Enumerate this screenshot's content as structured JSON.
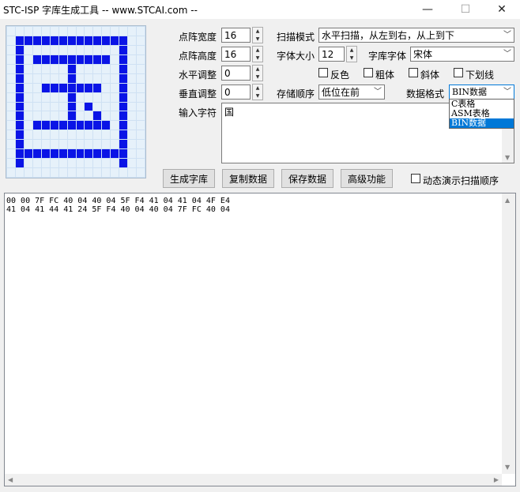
{
  "window": {
    "title": "STC-ISP 字库生成工具 -- www.STCAI.com --",
    "minimize_glyph": "—",
    "maximize_glyph": "☐",
    "close_glyph": "✕"
  },
  "dot_matrix": {
    "rows": [
      "0000000000000000",
      "0111111111111100",
      "0100000000000100",
      "0101111111110100",
      "0100000100000100",
      "0100000100000100",
      "0100111111100100",
      "0100000100000100",
      "0100000101000100",
      "0100000100100100",
      "0101111111110100",
      "0100000000000100",
      "0100000000000100",
      "0111111111111100",
      "0100000000000100",
      "0000000000000000"
    ]
  },
  "settings": {
    "width_label": "点阵宽度",
    "width_value": "16",
    "height_label": "点阵高度",
    "height_value": "16",
    "hadjust_label": "水平调整",
    "hadjust_value": "0",
    "vadjust_label": "垂直调整",
    "vadjust_value": "0",
    "scan_mode_label": "扫描模式",
    "scan_mode_value": "水平扫描，从左到右，从上到下",
    "font_size_label": "字体大小",
    "font_size_value": "12",
    "font_face_label": "字库字体",
    "font_face_value": "宋体",
    "storage_order_label": "存储顺序",
    "storage_order_value": "低位在前",
    "data_format_label": "数据格式",
    "data_format_value": "BIN数据",
    "data_format_options": [
      "C表格",
      "ASM表格",
      "BIN数据"
    ],
    "input_label": "输入字符",
    "input_value": "国"
  },
  "checkboxes": {
    "invert": "反色",
    "bold": "粗体",
    "italic": "斜体",
    "underline": "下划线",
    "animate": "动态演示扫描顺序"
  },
  "buttons": {
    "generate": "生成字库",
    "copy": "复制数据",
    "save": "保存数据",
    "advanced": "高级功能"
  },
  "output": {
    "lines": [
      "00 00 7F FC 40 04 40 04 5F F4 41 04 41 04 4F E4",
      "41 04 41 44 41 24 5F F4 40 04 40 04 7F FC 40 04"
    ]
  },
  "icons": {
    "spin_up": "▲",
    "spin_down": "▼",
    "dropdown": "﹀",
    "scroll_up": "▲",
    "scroll_down": "▼",
    "scroll_left": "◀",
    "scroll_right": "▶"
  }
}
